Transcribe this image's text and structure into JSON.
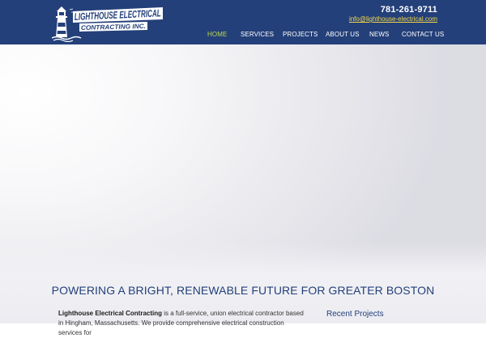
{
  "header": {
    "logo_line1": "LIGHTHOUSE ELECTRICAL",
    "logo_line2": "CONTRACTING INC.",
    "phone": "781-261-9711",
    "email": "info@lighthouse-electrical.com",
    "nav": [
      {
        "label": "HOME"
      },
      {
        "label": "SERVICES"
      },
      {
        "label": "PROJECTS"
      },
      {
        "label": "ABOUT US"
      },
      {
        "label": "NEWS"
      },
      {
        "label": "CONTACT US"
      }
    ]
  },
  "main": {
    "tagline": "POWERING A BRIGHT, RENEWABLE FUTURE FOR GREATER BOSTON",
    "intro_company": "Lighthouse Electrical Contracting",
    "intro_text": " is a full-service, union electrical contractor based in Hingham, Massachusetts.  We provide comprehensive electrical construction services for",
    "recent_projects_title": "Recent Projects"
  },
  "colors": {
    "header_bg": "#24407a",
    "nav_active": "#b9da52",
    "email_link": "#f3d948",
    "heading": "#24407a"
  }
}
